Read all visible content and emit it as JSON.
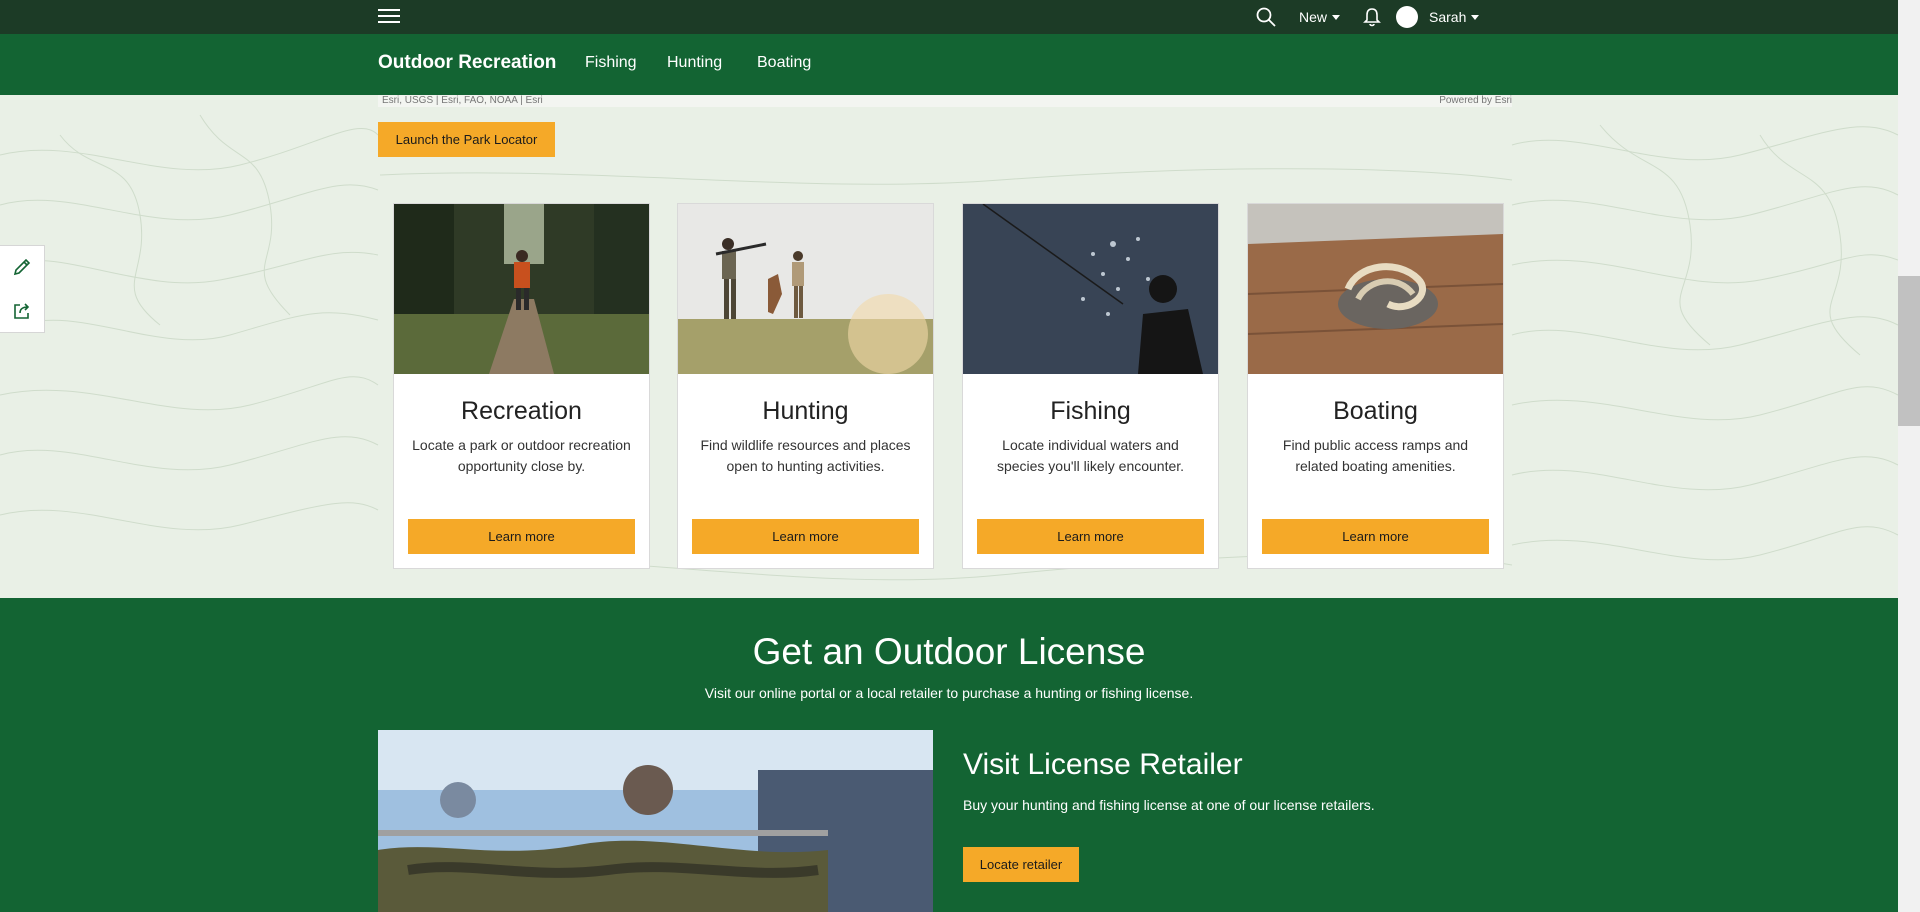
{
  "topbar": {
    "new_label": "New",
    "user_name": "Sarah"
  },
  "nav": {
    "title": "Outdoor Recreation",
    "links": [
      "Fishing",
      "Hunting",
      "Boating"
    ]
  },
  "map": {
    "credit_left": "Esri, USGS | Esri, FAO, NOAA | Esri",
    "credit_right": "Powered by Esri",
    "launch_button": "Launch the Park Locator"
  },
  "side_tools": [
    "pencil-icon",
    "share-icon"
  ],
  "cards": [
    {
      "title": "Recreation",
      "desc_line1": "Locate a park or outdoor recreation",
      "desc_line2": "opportunity close by.",
      "button": "Learn more"
    },
    {
      "title": "Hunting",
      "desc_line1": "Find wildlife resources and places",
      "desc_line2": "open to hunting activities.",
      "button": "Learn more"
    },
    {
      "title": "Fishing",
      "desc_line1": "Locate individual waters and",
      "desc_line2": "species you'll likely encounter.",
      "button": "Learn more"
    },
    {
      "title": "Boating",
      "desc_line1": "Find public access ramps and",
      "desc_line2": "related boating amenities.",
      "button": "Learn more"
    }
  ],
  "license": {
    "title": "Get an Outdoor License",
    "subtitle": "Visit our online portal or a local retailer to purchase a hunting or fishing license.",
    "retailer_title": "Visit License Retailer",
    "retailer_text": "Buy your hunting and fishing license at one of our license retailers.",
    "retailer_button": "Locate retailer"
  },
  "colors": {
    "topbar": "#1c3b26",
    "brand_green": "#136433",
    "accent_yellow": "#f5a928",
    "page_bg": "#e9f0e6"
  }
}
